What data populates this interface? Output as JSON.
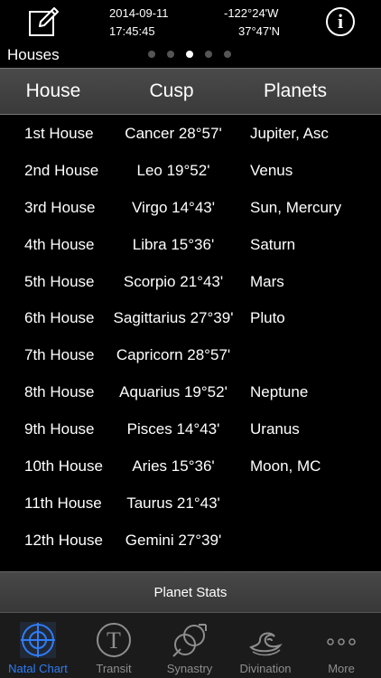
{
  "header": {
    "date": "2014-09-11",
    "time": "17:45:45",
    "longitude": "-122°24'W",
    "latitude": "37°47'N",
    "section_label": "Houses",
    "info_glyph": "i",
    "page_dots": 5,
    "active_dot": 2
  },
  "columns": {
    "house": "House",
    "cusp": "Cusp",
    "planets": "Planets"
  },
  "rows": [
    {
      "house": "1st House",
      "cusp": "Cancer 28°57'",
      "planets": "Jupiter, Asc"
    },
    {
      "house": "2nd House",
      "cusp": "Leo 19°52'",
      "planets": "Venus"
    },
    {
      "house": "3rd House",
      "cusp": "Virgo 14°43'",
      "planets": "Sun, Mercury"
    },
    {
      "house": "4th House",
      "cusp": "Libra 15°36'",
      "planets": "Saturn"
    },
    {
      "house": "5th House",
      "cusp": "Scorpio 21°43'",
      "planets": "Mars"
    },
    {
      "house": "6th House",
      "cusp": "Sagittarius 27°39'",
      "planets": "Pluto"
    },
    {
      "house": "7th House",
      "cusp": "Capricorn 28°57'",
      "planets": ""
    },
    {
      "house": "8th House",
      "cusp": "Aquarius 19°52'",
      "planets": "Neptune"
    },
    {
      "house": "9th House",
      "cusp": "Pisces 14°43'",
      "planets": "Uranus"
    },
    {
      "house": "10th House",
      "cusp": "Aries 15°36'",
      "planets": "Moon, MC"
    },
    {
      "house": "11th House",
      "cusp": "Taurus 21°43'",
      "planets": ""
    },
    {
      "house": "12th House",
      "cusp": "Gemini 27°39'",
      "planets": ""
    }
  ],
  "stats_button": "Planet Stats",
  "tabs": [
    {
      "label": "Natal Chart",
      "icon": "crosshair-icon",
      "active": true
    },
    {
      "label": "Transit",
      "icon": "transit-t-icon",
      "active": false
    },
    {
      "label": "Synastry",
      "icon": "synastry-icon",
      "active": false
    },
    {
      "label": "Divination",
      "icon": "divination-icon",
      "active": false
    },
    {
      "label": "More",
      "icon": "more-dots-icon",
      "active": false
    }
  ],
  "colors": {
    "accent": "#2f7cf6",
    "background": "#000000",
    "header_bar": "#404040",
    "tab_inactive": "#8e8e8e"
  }
}
